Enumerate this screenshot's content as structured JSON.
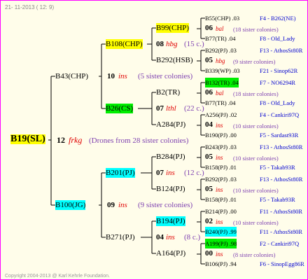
{
  "date": "21- 11-2013 ( 12: 9)",
  "copyright": "Copyright 2004-2013 @ Karl Kehrle Foundation.",
  "root": {
    "name": "B19(SL)",
    "num": "12",
    "code": "frkg",
    "drones": "(Drones from 28 sister colonies)"
  },
  "gen1": [
    {
      "name": "B43(CHP)",
      "num": "10",
      "code": "ins",
      "sis": "(5 sister colonies)"
    },
    {
      "name": "B100(JG)",
      "num": "09",
      "code": "ins",
      "sis": "(9 sister colonies)"
    }
  ],
  "gen2": [
    {
      "name": "B108(CHP)",
      "num": "",
      "code": "",
      "sis": ""
    },
    {
      "name": "B26(CS)",
      "num": "07",
      "code": "lthl",
      "sis": "(22 c.)"
    },
    {
      "name": "B201(PJ)",
      "num": "07",
      "code": "ins",
      "sis": "(12 c.)"
    },
    {
      "name": "B271(PJ)",
      "num": "04",
      "code": "ins",
      "sis": "(8 c.)"
    }
  ],
  "gen3": [
    {
      "name": "B99(CHP)",
      "num": "08",
      "code": "hbg",
      "sis": "(15 c.)"
    },
    {
      "name": "B292(HSB)",
      "num": "",
      "code": "",
      "sis": ""
    },
    {
      "name": "B2(TR)",
      "num": "",
      "code": "",
      "sis": ""
    },
    {
      "name": "A284(PJ)",
      "num": "",
      "code": "",
      "sis": ""
    },
    {
      "name": "B284(PJ)",
      "num": "",
      "code": "",
      "sis": ""
    },
    {
      "name": "B124(PJ)",
      "num": "",
      "code": "",
      "sis": ""
    },
    {
      "name": "B194(PJ)",
      "num": "",
      "code": "",
      "sis": ""
    },
    {
      "name": "A164(PJ)",
      "num": "",
      "code": "",
      "sis": ""
    }
  ],
  "right": [
    {
      "a": "B55(CHP) .03",
      "b": "F4 - B262(NE)",
      "n": "06",
      "c": "bal",
      "s": "(18 sister colonies)",
      "d": "B77(TR) .04",
      "e": "F8 - Old_Lady"
    },
    {
      "a": "B292(PJ) .03",
      "b": "F13 - AthosSt80R",
      "n": "05",
      "c": "hbg",
      "s": "(9 sister colonies)",
      "d": "B339(WP) .03",
      "e": "F21 - Sinop62R"
    },
    {
      "a": "B132(TR) .04",
      "b": "F7 - NO6294R",
      "n": "06",
      "c": "bal",
      "s": "(18 sister colonies)",
      "d": "B77(TR) .04",
      "e": "F8 - Old_Lady"
    },
    {
      "a": "A256(PJ) .02",
      "b": "F4 - Cankiri97Q",
      "n": "04",
      "c": "ins",
      "s": "(10 sister colonies)",
      "d": "B190(PJ) .00",
      "e": "F5 - Sardast93R"
    },
    {
      "a": "B243(PJ) .03",
      "b": "F13 - AthosSt80R",
      "n": "05",
      "c": "ins",
      "s": "(10 sister colonies)",
      "d": "B158(PJ) .01",
      "e": "F5 - Takab93R"
    },
    {
      "a": "B292(PJ) .03",
      "b": "F13 - AthosSt80R",
      "n": "05",
      "c": "ins",
      "s": "(10 sister colonies)",
      "d": "B158(PJ) .01",
      "e": "F5 - Takab93R"
    },
    {
      "a": "B214(PJ) .00",
      "b": "F11 - AthosSt80R",
      "n": "02",
      "c": "ins",
      "s": "(10 sister colonies)",
      "d": "B240(PJ) .99",
      "e": "F11 - AthosSt80R"
    },
    {
      "a": "A199(PJ) .98",
      "b": "F2 - Cankiri97Q",
      "n": "00",
      "c": "ins",
      "s": "(8 sister colonies)",
      "d": "B106(PJ) .94",
      "e": "F6 - SinopEgg86R"
    }
  ]
}
